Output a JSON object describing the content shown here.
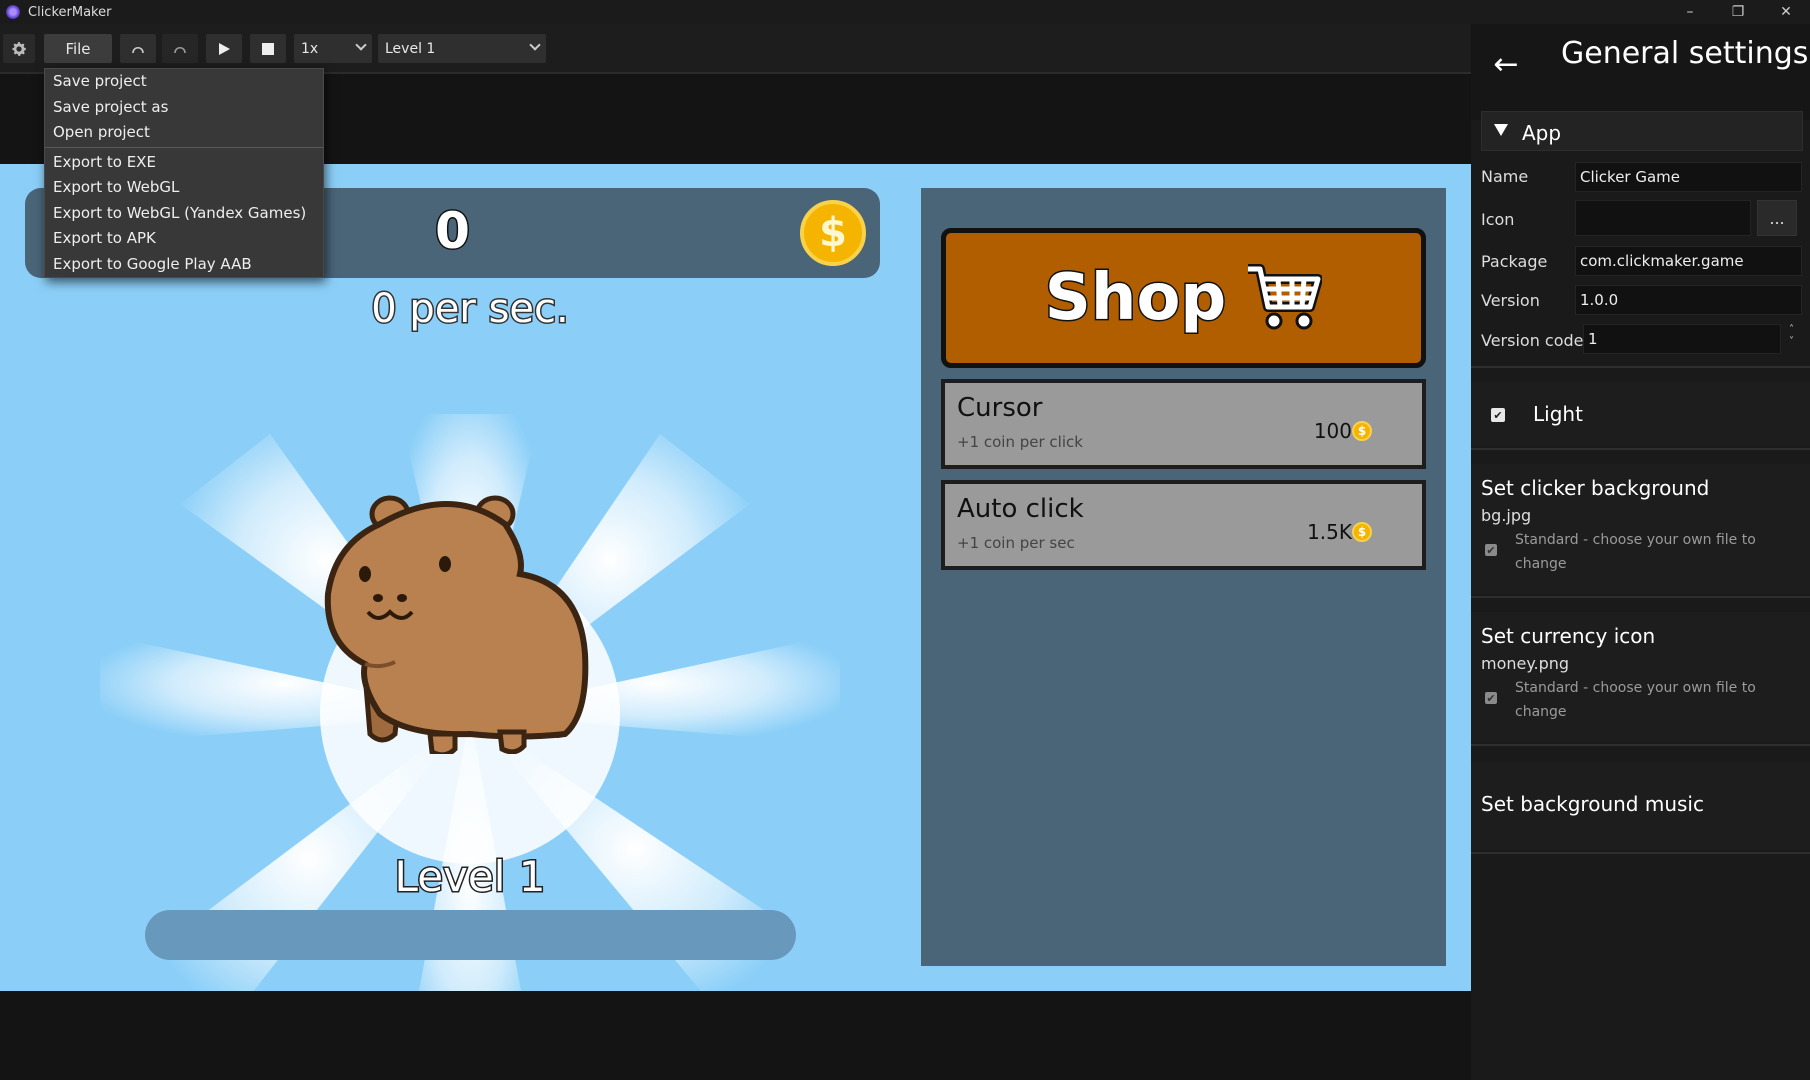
{
  "window": {
    "title": "ClickerMaker",
    "controls": {
      "minimize": "–",
      "restore": "❐",
      "close": "✕"
    }
  },
  "toolbar": {
    "settings_icon": "gear-icon",
    "file_label": "File",
    "undo_icon": "undo-icon",
    "redo_icon": "redo-icon",
    "play_icon": "play-icon",
    "stop_icon": "stop-icon",
    "speed_value": "1x",
    "level_value": "Level 1"
  },
  "file_menu": {
    "items": [
      "Save project",
      "Save project as",
      "Open project",
      "Export to EXE",
      "Export to WebGL",
      "Export to WebGL (Yandex Games)",
      "Export to APK",
      "Export to Google Play AAB"
    ]
  },
  "game": {
    "coins": "0",
    "coin_symbol": "$",
    "per_sec": "0 per sec.",
    "level_label": "Level 1",
    "level_progress": 0,
    "background_color": "#8bcff8",
    "panel_color": "#4a6478",
    "shop": {
      "label": "Shop",
      "cart_icon": "cart-icon",
      "button_color": "#b05e00",
      "items": [
        {
          "name": "Cursor",
          "desc": "+1 coin per click",
          "price": "100"
        },
        {
          "name": "Auto click",
          "desc": "+1 coin per sec",
          "price": "1.5K"
        }
      ]
    }
  },
  "settings": {
    "back_icon": "back-arrow-icon",
    "title": "General settings",
    "section_app": "App",
    "fields": {
      "name_label": "Name",
      "name_value": "Clicker Game",
      "icon_label": "Icon",
      "icon_value": "",
      "icon_browse": "...",
      "package_label": "Package",
      "package_value": "com.clickmaker.game",
      "version_label": "Version",
      "version_value": "1.0.0",
      "version_code_label": "Version code",
      "version_code_value": "1"
    },
    "light_label": "Light",
    "light_checked": true,
    "background": {
      "title": "Set clicker background",
      "file": "bg.jpg",
      "note": "Standard - choose your own file to change"
    },
    "currency": {
      "title": "Set currency icon",
      "file": "money.png",
      "note": "Standard - choose your own file to change"
    },
    "music": {
      "title": "Set background music"
    }
  }
}
